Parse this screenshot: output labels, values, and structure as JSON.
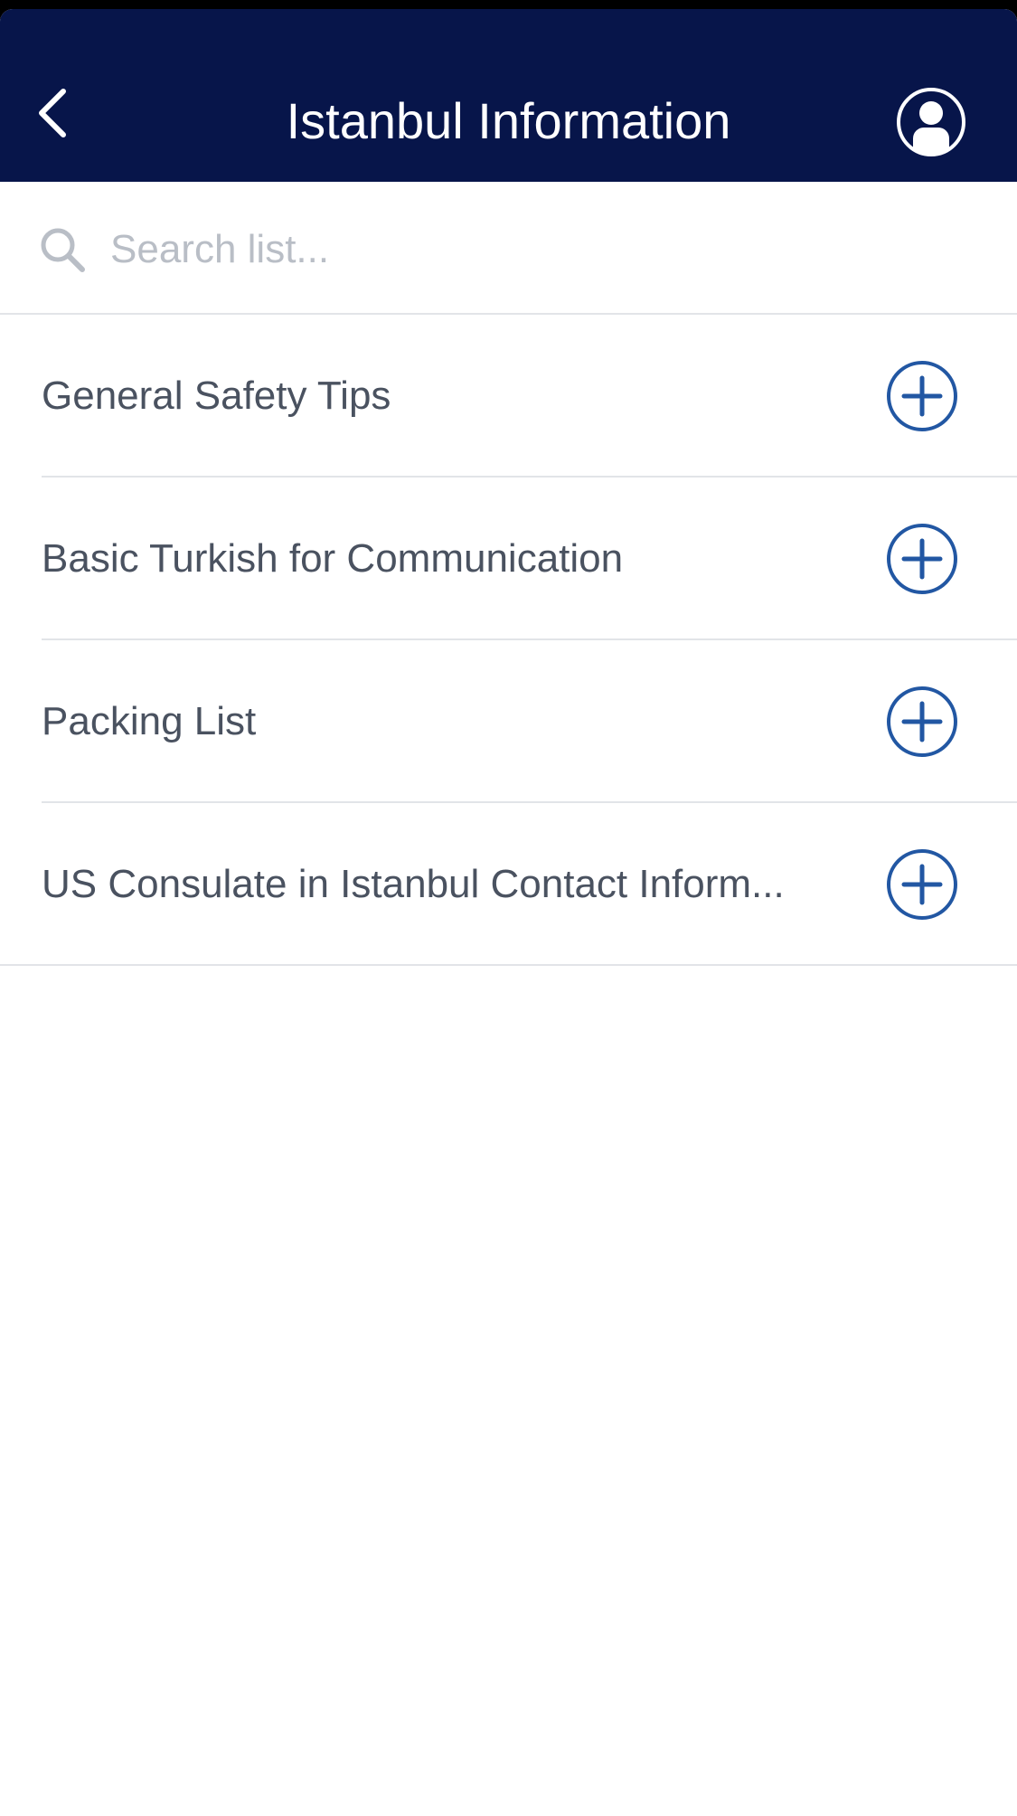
{
  "header": {
    "title": "Istanbul Information",
    "back_icon": "chevron-left-icon",
    "profile_icon": "user-circle-icon",
    "background_color": "#07154a"
  },
  "search": {
    "placeholder": "Search list...",
    "value": "",
    "icon": "search-icon"
  },
  "list": {
    "items": [
      {
        "label": "General Safety Tips",
        "action_icon": "plus-circle-icon"
      },
      {
        "label": "Basic Turkish for Communication",
        "action_icon": "plus-circle-icon"
      },
      {
        "label": "Packing List",
        "action_icon": "plus-circle-icon"
      },
      {
        "label": "US Consulate in Istanbul Contact Inform...",
        "action_icon": "plus-circle-icon"
      }
    ],
    "accent_color": "#2257a3"
  }
}
